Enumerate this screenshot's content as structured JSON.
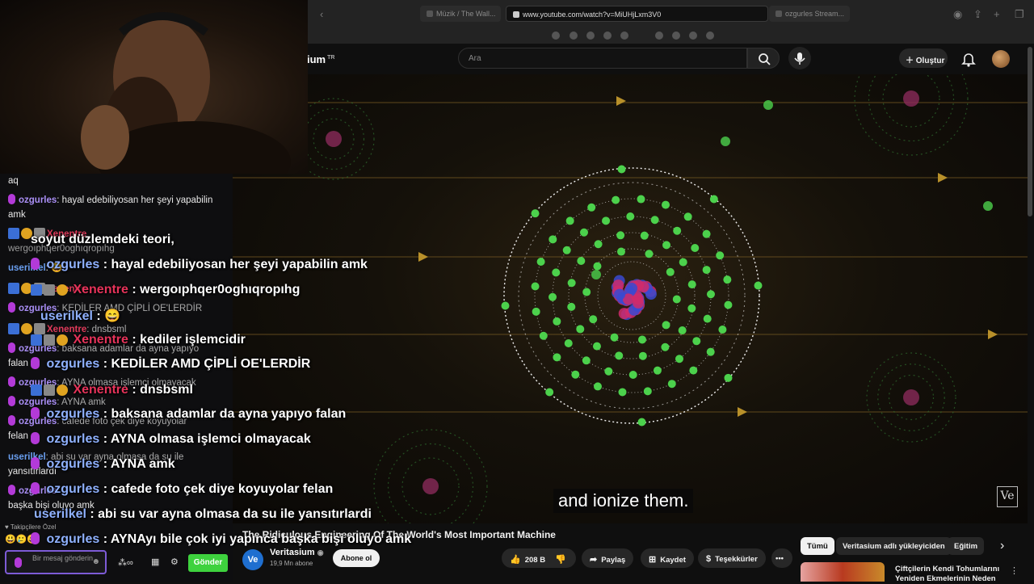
{
  "browser": {
    "tabs": [
      "Müzik / The Wall...",
      "www.youtube.com/watch?v=MiUHjLxm3V0",
      "ozgurles Stream..."
    ]
  },
  "youtube": {
    "logo": "ium",
    "logo_sup": "TR",
    "search_placeholder": "Ara",
    "create_label": "Oluştur"
  },
  "video": {
    "subtitle": "and ionize them.",
    "watermark": "Ve",
    "title": "The Ridiculous Engineering Of The World's Most Important Machine",
    "channel": "Veritasium",
    "channel_avatar": "Ve",
    "subscribers": "19,9 Mn abone",
    "subscribe_label": "Abone ol",
    "likes": "208 B",
    "share_label": "Paylaş",
    "save_label": "Kaydet",
    "thanks_label": "Teşekkürler",
    "more_label": "•••"
  },
  "sidebar": {
    "chips": [
      "Tümü",
      "Veritasium adlı yükleyiciden",
      "Eğitim"
    ],
    "recommended_title": "Çiftçilerin Kendi Tohumlarını Yeniden Ekmelerinin Neden"
  },
  "chat": {
    "messages": [
      {
        "user": "",
        "text": "aq"
      },
      {
        "user": "ozgurles",
        "text": ": hayal edebiliyosan her şeyi yapabilin amk"
      },
      {
        "user": "Xenentre",
        "text": ""
      },
      {
        "user": "",
        "text": "wergoıphqer0oghıqropıhg"
      },
      {
        "user": "userilkel",
        "text": ": 😄"
      },
      {
        "user": "Xenentre",
        "text": ""
      },
      {
        "user": "ozgurles",
        "text": ": KEDİLER AMD ÇİPLİ OE'LERDİR"
      },
      {
        "user": "Xenentre",
        "text": ": dnsbsml"
      },
      {
        "user": "ozgurles",
        "text": ": baksana adamlar da ayna yapıyo"
      },
      {
        "user": "",
        "text": "falan"
      },
      {
        "user": "ozgurles",
        "text": ": AYNA olmasa işlemci olmayacak"
      },
      {
        "user": "ozgurles",
        "text": ": AYNA amk"
      },
      {
        "user": "ozgurles",
        "text": ": cafede foto çek diye koyuyolar"
      },
      {
        "user": "",
        "text": "felan"
      },
      {
        "user": "userilkel",
        "text": ": abi su var ayna olmasa da su ile"
      },
      {
        "user": "",
        "text": "yansıtırlardı"
      },
      {
        "user": "ozgurles",
        "text": ""
      },
      {
        "user": "",
        "text": "başka bişi oluyo amk"
      }
    ],
    "followers_note": "Takipçilere Özel",
    "input_placeholder": "Bir mesaj gönderin",
    "send_label": "Gönder"
  },
  "overlay": {
    "lines": [
      {
        "user": "",
        "text": "soyut düzlemdeki teori,"
      },
      {
        "user": "ozgurles",
        "text": " : hayal edebiliyosan her şeyi yapabilin amk"
      },
      {
        "user": "Xenentre",
        "text": " : wergoıphqer0oghıqropıhg"
      },
      {
        "user": "userilkel",
        "text": " : 😄"
      },
      {
        "user": "Xenentre",
        "text": " : kediler işlemcidir"
      },
      {
        "user": "ozgurles",
        "text": " : KEDİLER AMD ÇİPLİ OE'LERDİR"
      },
      {
        "user": "Xenentre",
        "text": " : dnsbsml"
      },
      {
        "user": "ozgurles",
        "text": " : baksana adamlar da ayna yapıyo falan"
      },
      {
        "user": "ozgurles",
        "text": " : AYNA olmasa işlemci olmayacak"
      },
      {
        "user": "ozgurles",
        "text": " : AYNA amk"
      },
      {
        "user": "ozgurles",
        "text": " : cafede foto çek diye koyuyolar felan"
      },
      {
        "user": "userilkel",
        "text": " : abi su var ayna olmasa da su ile yansıtırlardi"
      },
      {
        "user": "ozgurles",
        "text": " : AYNAyı bile çok iyi yapınca başka bişi oluyo amk"
      }
    ]
  },
  "colors": {
    "username_purple": "#a98ef5",
    "username_blue": "#8fb1ff",
    "username_red": "#e6335a",
    "send_green": "#3ed23e",
    "electron_green": "#4cd14c"
  }
}
